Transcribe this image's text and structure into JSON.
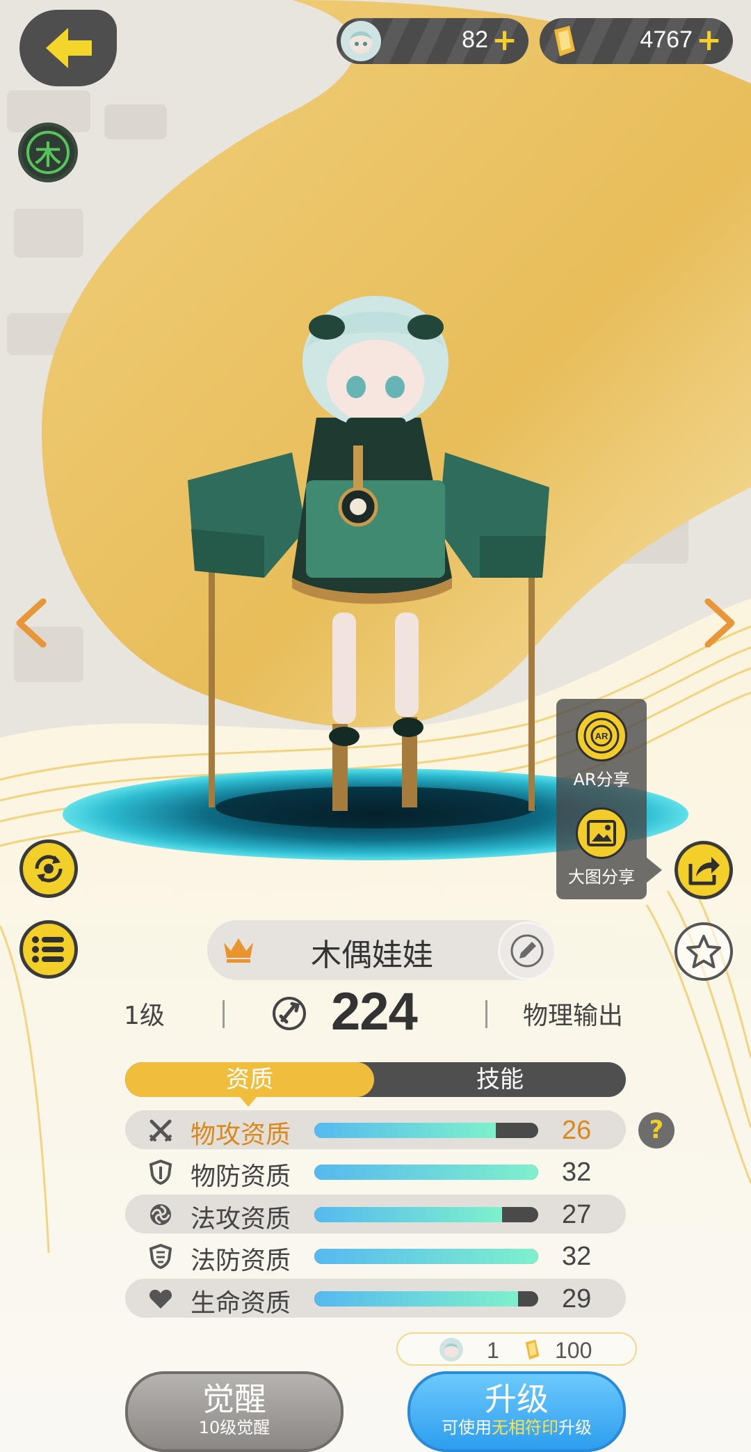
{
  "resources": {
    "spirit_count": "82",
    "gold_count": "4767",
    "plus_symbol": "+"
  },
  "element_badge": "木",
  "share": {
    "ar_label": "AR分享",
    "image_label": "大图分享",
    "ar_icon_text": "AR"
  },
  "character": {
    "name": "木偶娃娃",
    "level": "1级",
    "power": "224",
    "role": "物理输出"
  },
  "tabs": [
    {
      "label": "资质",
      "active": true
    },
    {
      "label": "技能",
      "active": false
    }
  ],
  "aptitudes": [
    {
      "label": "物攻资质",
      "value": "26",
      "fill": 0.81,
      "icon": "crossed-swords-icon",
      "highlight": true
    },
    {
      "label": "物防资质",
      "value": "32",
      "fill": 1.0,
      "icon": "shield-icon",
      "highlight": false
    },
    {
      "label": "法攻资质",
      "value": "27",
      "fill": 0.84,
      "icon": "magic-orb-icon",
      "highlight": false
    },
    {
      "label": "法防资质",
      "value": "32",
      "fill": 1.0,
      "icon": "shield-icon",
      "highlight": false
    },
    {
      "label": "生命资质",
      "value": "29",
      "fill": 0.91,
      "icon": "heart-icon",
      "highlight": false
    }
  ],
  "help_symbol": "?",
  "cost": {
    "spirit": "1",
    "gold": "100"
  },
  "buttons": {
    "awaken_label": "觉醒",
    "awaken_sub": "10级觉醒",
    "upgrade_label": "升级",
    "upgrade_sub_prefix": "可使用",
    "upgrade_sub_highlight": "无相符印",
    "upgrade_sub_suffix": "升级"
  },
  "colors": {
    "accent_yellow": "#f2cc2a",
    "tab_active": "#f0bd3c",
    "highlight_orange": "#d9881b",
    "upgrade_blue": "#2e9ef0"
  }
}
